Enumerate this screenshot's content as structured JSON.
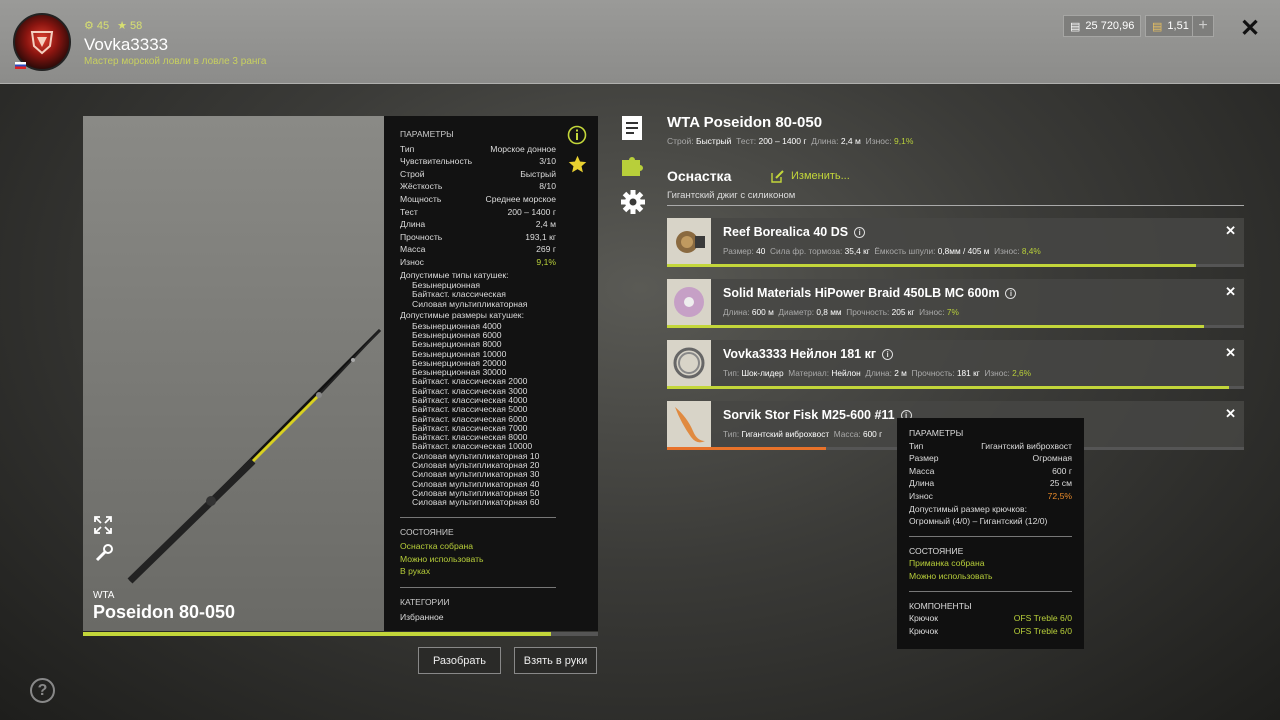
{
  "player": {
    "level": "45",
    "rank": "58",
    "name": "Vovka3333",
    "title": "Мастер морской ловли в ловле 3 ранга"
  },
  "currency": {
    "silver": "25 720,96",
    "gold": "1,51",
    "add": "+"
  },
  "rod": {
    "brand": "WTA",
    "model": "Poseidon 80-050",
    "title": "WTA Poseidon 80-050",
    "wear_fraction": 0.909,
    "summary": {
      "action_label": "Строй:",
      "action": "Быстрый",
      "test_label": "Тест:",
      "test": "200 – 1400 г",
      "length_label": "Длина:",
      "length": "2,4 м",
      "wear_label": "Износ:",
      "wear": "9,1%"
    }
  },
  "params": {
    "header": "ПАРАМЕТРЫ",
    "rows": [
      {
        "k": "Тип",
        "v": "Морское донное"
      },
      {
        "k": "Чувствительность",
        "v": "3/10"
      },
      {
        "k": "Строй",
        "v": "Быстрый"
      },
      {
        "k": "Жёсткость",
        "v": "8/10"
      },
      {
        "k": "Мощность",
        "v": "Среднее морское"
      },
      {
        "k": "Тест",
        "v": "200 – 1400 г"
      },
      {
        "k": "Длина",
        "v": "2,4 м"
      },
      {
        "k": "Прочность",
        "v": "193,1 кг"
      },
      {
        "k": "Масса",
        "v": "269 г"
      },
      {
        "k": "Износ",
        "v": "9,1%"
      }
    ],
    "reel_types_label": "Допустимые типы катушек:",
    "reel_types": [
      "Безынерционная",
      "Байткаст. классическая",
      "Силовая мультипликаторная"
    ],
    "reel_sizes_label": "Допустимые размеры катушек:",
    "reel_sizes": [
      "Безынерционная 4000",
      "Безынерционная 6000",
      "Безынерционная 8000",
      "Безынерционная 10000",
      "Безынерционная 20000",
      "Безынерционная 30000",
      "Байткаст. классическая 2000",
      "Байткаст. классическая 3000",
      "Байткаст. классическая 4000",
      "Байткаст. классическая 5000",
      "Байткаст. классическая 6000",
      "Байткаст. классическая 7000",
      "Байткаст. классическая 8000",
      "Байткаст. классическая 10000",
      "Силовая мультипликаторная 10",
      "Силовая мультипликаторная 20",
      "Силовая мультипликаторная 30",
      "Силовая мультипликаторная 40",
      "Силовая мультипликаторная 50",
      "Силовая мультипликаторная 60"
    ],
    "state_header": "СОСТОЯНИЕ",
    "states": [
      "Оснастка собрана",
      "Можно использовать",
      "В руках"
    ],
    "categories_header": "КАТЕГОРИИ",
    "category": "Избранное"
  },
  "buttons": {
    "disassemble": "Разобрать",
    "take": "Взять в руки"
  },
  "tackle": {
    "header": "Оснастка",
    "edit": "Изменить...",
    "subtitle": "Гигантский джиг с силиконом",
    "items": [
      {
        "name": "Reef Borealica 40 DS",
        "meta": [
          [
            "Размер:",
            "40"
          ],
          [
            "Сила фр. тормоза:",
            "35,4 кг"
          ],
          [
            "Ёмкость шпули:",
            "0,8мм / 405 м"
          ],
          [
            "Износ:",
            "8,4%"
          ]
        ],
        "wear_fraction": 0.916,
        "bar_color": "#c3d63a"
      },
      {
        "name": "Solid Materials HiPower Braid 450LB MC 600m",
        "meta": [
          [
            "Длина:",
            "600 м"
          ],
          [
            "Диаметр:",
            "0,8 мм"
          ],
          [
            "Прочность:",
            "205 кг"
          ],
          [
            "Износ:",
            "7%"
          ]
        ],
        "wear_fraction": 0.93,
        "bar_color": "#c3d63a"
      },
      {
        "name": "Vovka3333 Нейлон 181 кг",
        "meta": [
          [
            "Тип:",
            "Шок-лидер"
          ],
          [
            "Материал:",
            "Нейлон"
          ],
          [
            "Длина:",
            "2 м"
          ],
          [
            "Прочность:",
            "181 кг"
          ],
          [
            "Износ:",
            "2,6%"
          ]
        ],
        "wear_fraction": 0.974,
        "bar_color": "#c3d63a"
      },
      {
        "name": "Sorvik Stor Fisk M25-600 #11",
        "meta": [
          [
            "Тип:",
            "Гигантский виброхвост"
          ],
          [
            "Масса:",
            "600 г"
          ]
        ],
        "wear_fraction": 0.275,
        "bar_color": "#e8722a"
      }
    ]
  },
  "tooltip": {
    "header": "ПАРАМЕТРЫ",
    "rows": [
      {
        "k": "Тип",
        "v": "Гигантский виброхвост"
      },
      {
        "k": "Размер",
        "v": "Огромная"
      },
      {
        "k": "Масса",
        "v": "600 г"
      },
      {
        "k": "Длина",
        "v": "25 см"
      },
      {
        "k": "Износ",
        "v": "72,5%"
      }
    ],
    "hook_label": "Допустимый размер крючков:",
    "hook_value": "Огромный (4/0) – Гигантский (12/0)",
    "state_header": "СОСТОЯНИЕ",
    "states": [
      "Приманка собрана",
      "Можно использовать"
    ],
    "components_header": "КОМПОНЕНТЫ",
    "components": [
      {
        "k": "Крючок",
        "v": "OFS Treble 6/0"
      },
      {
        "k": "Крючок",
        "v": "OFS Treble 6/0"
      }
    ]
  },
  "help": "?",
  "close": "✕"
}
